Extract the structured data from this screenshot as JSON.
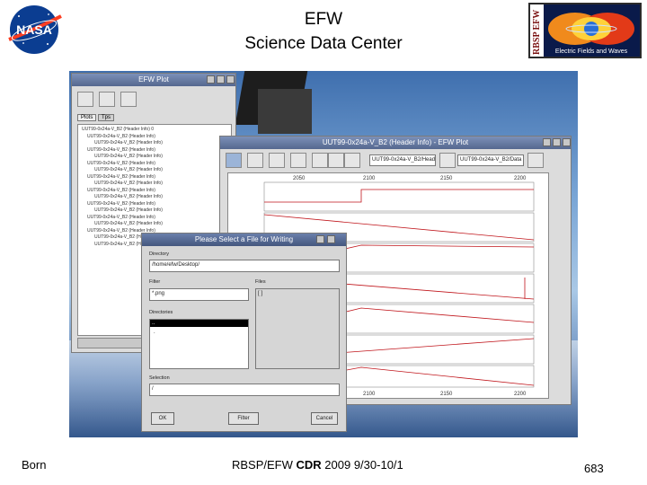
{
  "header": {
    "title_line1": "EFW",
    "title_line2": "Science Data Center",
    "nasa_logo_text": "NASA",
    "rbsp_logo_vertical": "RBSP EFW",
    "rbsp_logo_caption": "Electric Fields and Waves"
  },
  "screenshot": {
    "efw_plot_window": {
      "title": "EFW Plot",
      "tabs": [
        "Plots",
        "Tps"
      ],
      "tree_items": [
        "UUT99-0x24a-V_B2 (Header Info) 0",
        "UUT99-0x24a-V_B2 (Header Info)",
        "UUT99-0x24a-V_B2 (Header Info)",
        "UUT99-0x24a-V_B2 (Header Info)",
        "UUT99-0x24a-V_B2 (Header Info)",
        "UUT99-0x24a-V_B2 (Header Info)",
        "UUT99-0x24a-V_B2 (Header Info)",
        "UUT99-0x24a-V_B2 (Header Info)",
        "UUT99-0x24a-V_B2 (Header Info)",
        "UUT99-0x24a-V_B2 (Header Info)",
        "UUT99-0x24a-V_B2 (Header Info)",
        "UUT99-0x24a-V_B2 (Header Info)",
        "UUT99-0x24a-V_B2 (Header Info)",
        "UUT99-0x24a-V_B2 (Header Info)",
        "UUT99-0x24a-V_B2 (Header Info)",
        "UUT99-0x24a-V_B2 (Header Info)",
        "UUT99-0x24a-V_B2 (Header Info)",
        "UUT99-0x24a-V_B2 (Header Info)"
      ]
    },
    "header_info_window": {
      "title": "UUT99-0x24a-V_B2 (Header Info) - EFW Plot",
      "field1": "UUT99-0x24a-V_B2/Header",
      "field2": "UUT99-0x24a-V_B2/Data",
      "axis_top_labels": [
        "2050",
        "2100",
        "2150",
        "2200"
      ],
      "axis_bottom_labels": [
        "2100",
        "2150",
        "2200"
      ]
    },
    "file_dialog": {
      "title": "Please Select a File for Writing",
      "directory_label": "Directory",
      "directory_value": "/home/efw/Desktop/",
      "filter_label": "Filter",
      "filter_value": "*.png",
      "files_label": "Files",
      "files_value": "[   ]",
      "directories_label": "Directories",
      "directories_items": [
        "..",
        "."
      ],
      "selection_label": "Selection",
      "selection_value": "/",
      "ok_label": "OK",
      "filter_button_label": "Filter",
      "cancel_label": "Cancel"
    }
  },
  "footer": {
    "left": "Born",
    "center_prefix": "RBSP/EFW ",
    "center_bold": "CDR",
    "center_suffix": " 2009 9/30-10/1",
    "page_number": "683"
  }
}
